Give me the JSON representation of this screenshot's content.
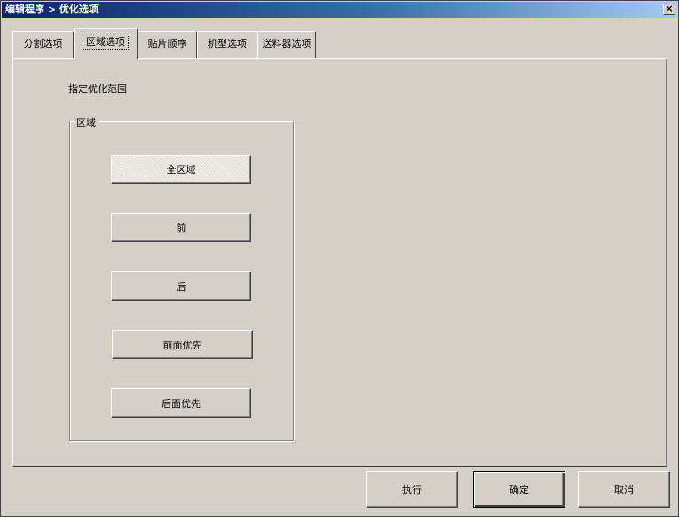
{
  "window": {
    "title": "编辑程序 > 优化选项",
    "close_label": "×"
  },
  "tabs": [
    {
      "label": "分割选项",
      "active": false
    },
    {
      "label": "区域选项",
      "active": true
    },
    {
      "label": "贴片顺序",
      "active": false
    },
    {
      "label": "机型选项",
      "active": false
    },
    {
      "label": "送料器选项",
      "active": false
    }
  ],
  "panel": {
    "range_label": "指定优化范围",
    "group_title": "区域",
    "buttons": [
      {
        "label": "全区域"
      },
      {
        "label": "前"
      },
      {
        "label": "后"
      },
      {
        "label": "前面优先"
      },
      {
        "label": "后面优先"
      }
    ]
  },
  "footer": {
    "execute": "执行",
    "ok": "确定",
    "cancel": "取消"
  }
}
